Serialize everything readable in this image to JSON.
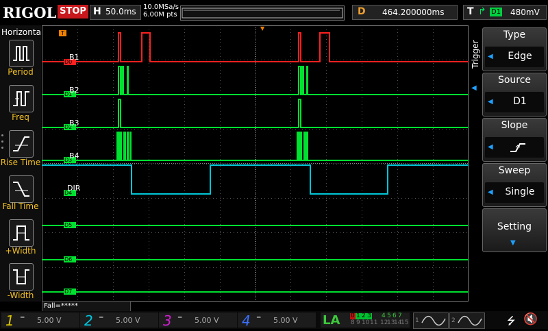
{
  "header": {
    "logo": "RIGOL",
    "run_state": "STOP",
    "timebase_letter": "H",
    "timebase": "50.0ms",
    "sample_rate": "10.0MSa/s",
    "memory_depth": "6.00M pts",
    "delay_letter": "D",
    "delay": "464.200000ms",
    "trigger_letter": "T",
    "trigger_source": "D1",
    "trigger_level": "480mV"
  },
  "left_menu": {
    "title": "Horizontal",
    "items": [
      {
        "label": "Period"
      },
      {
        "label": "Freq"
      },
      {
        "label": "Rise Time"
      },
      {
        "label": "Fall Time"
      },
      {
        "label": "+Width"
      },
      {
        "label": "-Width"
      }
    ]
  },
  "waveform": {
    "trigger_marker": "T",
    "channels": [
      {
        "marker": "D0",
        "label": "B1"
      },
      {
        "marker": "D1",
        "label": "B2"
      },
      {
        "marker": "D2",
        "label": "B3"
      },
      {
        "marker": "D3",
        "label": "B4"
      },
      {
        "marker": "D4",
        "label": "DIR"
      },
      {
        "marker": "D5",
        "label": ""
      },
      {
        "marker": "D6",
        "label": ""
      },
      {
        "marker": "D7",
        "label": ""
      }
    ],
    "colors": {
      "d0": "#ff2020",
      "d1_d3": "#00e030",
      "d4": "#00c8d8",
      "idle": "#00e030"
    },
    "status_line": "Fall=*****"
  },
  "right_menu": {
    "side_title": "Trigger",
    "type": {
      "title": "Type",
      "value": "Edge"
    },
    "source": {
      "title": "Source",
      "value": "D1"
    },
    "slope": {
      "title": "Slope",
      "value": "rising-edge-icon"
    },
    "sweep": {
      "title": "Sweep",
      "value": "Single"
    },
    "setting": {
      "title": "Setting"
    }
  },
  "footer": {
    "channels": [
      {
        "num": "1",
        "volts": "5.00 V",
        "color": "#d8c200"
      },
      {
        "num": "2",
        "volts": "5.00 V",
        "color": "#00c8e0"
      },
      {
        "num": "3",
        "volts": "5.00 V",
        "color": "#d020d0"
      },
      {
        "num": "4",
        "volts": "5.00 V",
        "color": "#3a70ff"
      }
    ],
    "la_label": "LA",
    "la_bank_low_top": [
      "0",
      "1",
      "2",
      "3"
    ],
    "la_bank_low_bottom": [
      "8",
      "9",
      "10",
      "11"
    ],
    "la_bank_high_top": [
      "4",
      "5",
      "6",
      "7"
    ],
    "la_bank_high_bottom": [
      "12",
      "13",
      "14",
      "15"
    ],
    "gen1": "1",
    "gen2": "2"
  }
}
